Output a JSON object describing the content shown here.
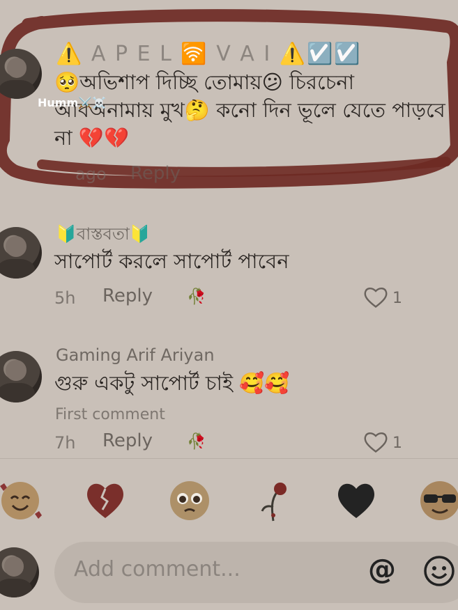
{
  "comments": [
    {
      "username": "⚠️ A P E L 🛜 V A I ⚠️☑️☑️",
      "text_line1": "🥺অভিশাপ দিচ্ছি তোমায়😕 চিরচেনা",
      "text_line2": "আবঅনামায় মুখ🤔 কনো দিন ভূলে যেতে পাড়বে",
      "text_line3": "না 💔💔",
      "time": "ago",
      "reply": "Reply"
    },
    {
      "username": "🔰বাস্তবতা🔰",
      "text": "সাপোর্ট করলে সাপোর্ট পাবেন",
      "time": "5h",
      "reply": "Reply",
      "likes": "1"
    },
    {
      "username": "Gaming Arif Ariyan",
      "text": "গুরু একটু সাপোর্ট চাই 🥰🥰",
      "note": "First comment",
      "time": "7h",
      "reply": "Reply",
      "likes": "1"
    }
  ],
  "watermark": "Humm⚔️☠️",
  "emoji_bar": [
    "🥰",
    "💔",
    "🥺",
    "🥀",
    "🖤",
    "😎"
  ],
  "input": {
    "placeholder": "Add comment..."
  },
  "icons": {
    "mention": "@",
    "emoji": "smile-icon"
  },
  "colors": {
    "background": "#c9c0b8",
    "scribble": "#6e2a24",
    "heart_red": "#9b3a3a"
  }
}
